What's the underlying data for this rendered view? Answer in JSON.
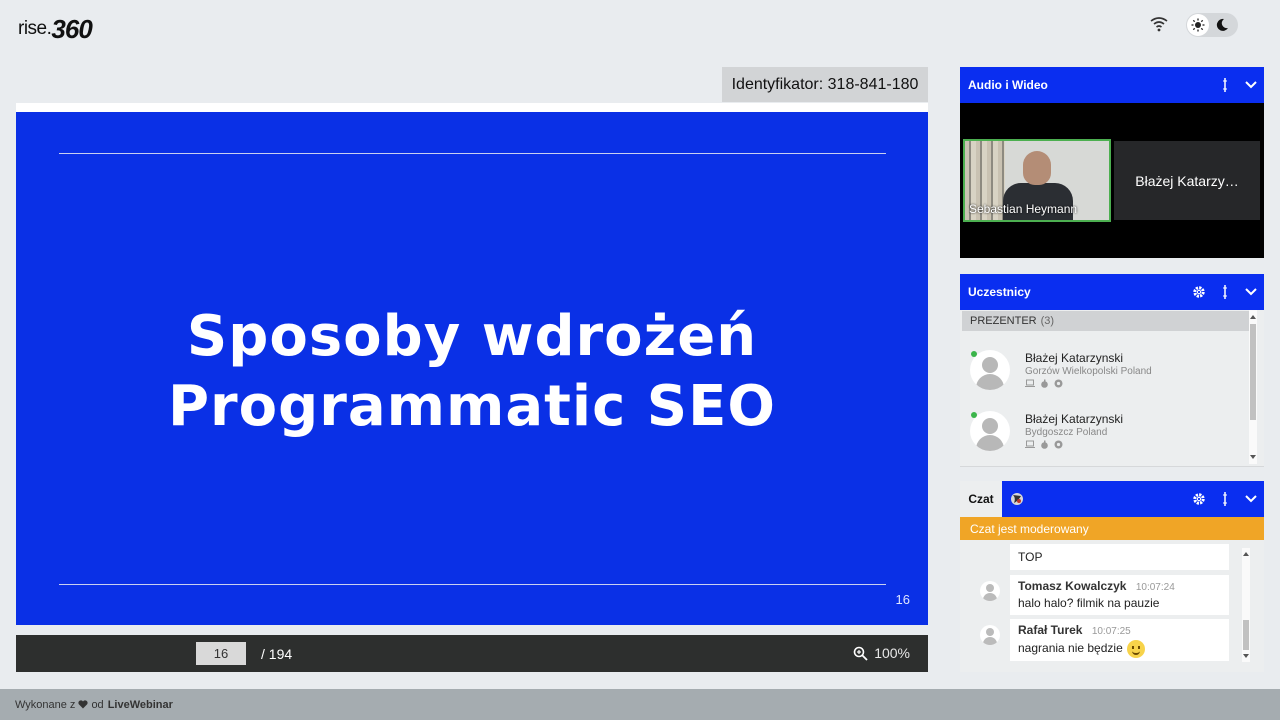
{
  "header": {
    "logo_part1": "rise.",
    "logo_part2": "360"
  },
  "meeting": {
    "id_label": "Identyfikator: 318-841-180"
  },
  "slide": {
    "title_line1": "Sposoby wdrożeń",
    "title_line2": "Programmatic SEO",
    "page_number": "16",
    "background_color": "#0a30e6"
  },
  "controls": {
    "current_page": "16",
    "total_pages": "/ 194",
    "zoom": "100%"
  },
  "audio_video": {
    "title": "Audio i Wideo",
    "tiles": [
      {
        "name": "Sebastian Heymann"
      },
      {
        "name": "Błażej Katarzy…"
      }
    ]
  },
  "participants": {
    "title": "Uczestnicy",
    "group_label": "PREZENTER",
    "group_count": "(3)",
    "people": [
      {
        "name": "Błażej Katarzynski",
        "location": "Gorzów Wielkopolski Poland"
      },
      {
        "name": "Błażej Katarzynski",
        "location": "Bydgoszcz Poland"
      }
    ]
  },
  "chat": {
    "tab_label": "Czat",
    "moderated_notice": "Czat jest moderowany",
    "messages": [
      {
        "author": "",
        "time": "",
        "text": "TOP"
      },
      {
        "author": "Tomasz Kowalczyk",
        "time": "10:07:24",
        "text": "halo halo? filmik na pauzie"
      },
      {
        "author": "Rafał Turek",
        "time": "10:07:25",
        "text": "nagrania nie będzie"
      }
    ]
  },
  "footer": {
    "made_with": "Wykonane z",
    "by": "od",
    "brand": "LiveWebinar"
  },
  "colors": {
    "accent": "#0a2ef0",
    "moderated": "#f0a526",
    "online": "#3bb54a"
  }
}
